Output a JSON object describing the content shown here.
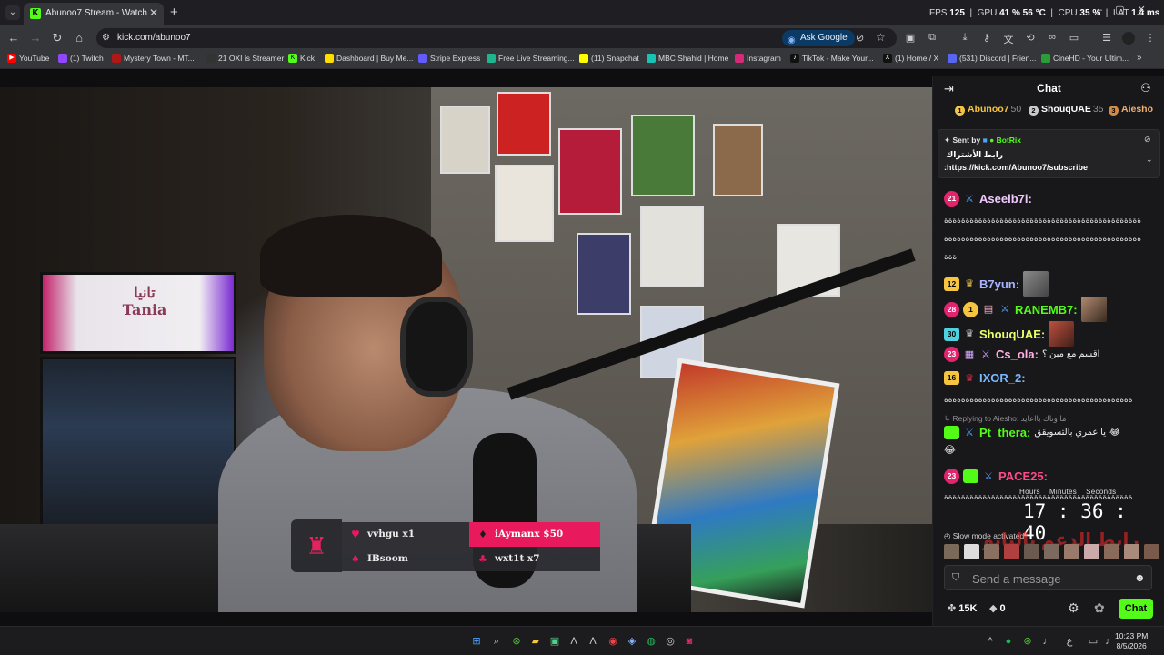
{
  "browser": {
    "tab_title": "Abunoo7 Stream - Watch Live on Kick",
    "url": "kick.com/abunoo7",
    "ask_google": "Ask Google",
    "perf": {
      "fps_label": "FPS",
      "fps": "125",
      "gpu_label": "GPU",
      "gpu": "41 %",
      "gpu_temp": "56 °C",
      "cpu_label": "CPU",
      "cpu": "35 %",
      "lat_label": "LAT",
      "lat": "1.4 ms"
    }
  },
  "bookmarks": [
    {
      "label": "YouTube",
      "color": "#ff0000"
    },
    {
      "label": "(1) Twitch",
      "color": "#9146ff"
    },
    {
      "label": "Mystery Town - MT...",
      "color": "#b01818"
    },
    {
      "label": "21 OXI is Streamer",
      "color": "#333333"
    },
    {
      "label": "Kick",
      "color": "#53fc18"
    },
    {
      "label": "Dashboard | Buy Me...",
      "color": "#ffdd00"
    },
    {
      "label": "Stripe Express",
      "color": "#635bff"
    },
    {
      "label": "Free Live Streaming...",
      "color": "#1fb58f"
    },
    {
      "label": "(11) Snapchat",
      "color": "#fffc00"
    },
    {
      "label": "MBC Shahid | Home",
      "color": "#17c3b2"
    },
    {
      "label": "Instagram",
      "color": "#d62976"
    },
    {
      "label": "TikTok - Make Your...",
      "color": "#111111"
    },
    {
      "label": "(1) Home / X",
      "color": "#111111"
    },
    {
      "label": "(531) Discord | Frien...",
      "color": "#5865f2"
    },
    {
      "label": "CineHD - Your Ultim...",
      "color": "#2a9d3a"
    }
  ],
  "donations": {
    "left": [
      {
        "text": "vvhgu x1"
      },
      {
        "text": "IBsoom"
      }
    ],
    "right": [
      {
        "text": "iAymanx $50"
      },
      {
        "text": "wxt1t x7"
      }
    ]
  },
  "chat": {
    "title": "Chat",
    "leaderboard": [
      {
        "rank": "1",
        "name": "Abunoo7",
        "score": "50",
        "color": "#f5c542"
      },
      {
        "rank": "2",
        "name": "ShouqUAE",
        "score": "35",
        "color": "#c9c9c9"
      },
      {
        "rank": "3",
        "name": "Aiesho",
        "score": "",
        "color": "#d08a4a"
      }
    ],
    "pinned": {
      "sent_by": "Sent by",
      "bot": "BotRix",
      "text": "رابط الأشتراك",
      "link": ":https://kick.com/Abunoo7/subscribe"
    },
    "messages": {
      "m1": {
        "badge": "21",
        "user": "Aseelb7i:",
        "color": "#f0c8ff",
        "line1": "ةةةةةةةةةةةةةةةةةةةةةةةةةةةةةةةةةةةةةةةةةةةةةة",
        "line2": "ةةةةةةةةةةةةةةةةةةةةةةةةةةةةةةةةةةةةةةةةةةةةةة",
        "line3": "ةةة"
      },
      "m2": {
        "badge": "12",
        "user": "B7yun:",
        "color": "#a8b4ff"
      },
      "m3": {
        "badge": "28",
        "badge2": "1",
        "user": "RANEMB7:",
        "color": "#53fc18"
      },
      "m4": {
        "badge": "30",
        "user": "ShouqUAE:",
        "color": "#e6ff6a"
      },
      "m5": {
        "badge": "23",
        "user": "Cs_ola:",
        "color": "#ffb0e0",
        "text": "اقسم مع مين ؟"
      },
      "m6": {
        "badge": "16",
        "user": "IXOR_2:",
        "color": "#7ab8ff",
        "line1": "ةةةةةةةةةةةةةةةةةةةةةةةةةةةةةةةةةةةةةةةةةةةة"
      },
      "reply_to": "Replying to Aiesho:",
      "reply_snippet": "ما وناك يااعايد",
      "m7": {
        "user": "Pt_thera:",
        "color": "#53fc18",
        "text": "يا عمري بالتسويقق",
        "emoji": "😂"
      },
      "m8": {
        "badge": "23",
        "user": "PACE25:",
        "color": "#ff4a8a",
        "line1": "ةةةةةةةةةةةةةةةةةةةةةةةةةةةةةةةةةةةةةةةةةةةة"
      }
    },
    "timer": {
      "hours": "Hours",
      "minutes": "Minutes",
      "seconds": "Seconds",
      "value": "17 : 36 : 40"
    },
    "slow_mode": "Slow mode activated",
    "support_overlay": "رابط الدعم بالبايو",
    "input_placeholder": "Send a message",
    "points": "15K",
    "kicks": "0",
    "send_label": "Chat"
  },
  "taskbar": {
    "time": "10:23 PM",
    "date": "8/5/2026",
    "lang": "ع"
  }
}
